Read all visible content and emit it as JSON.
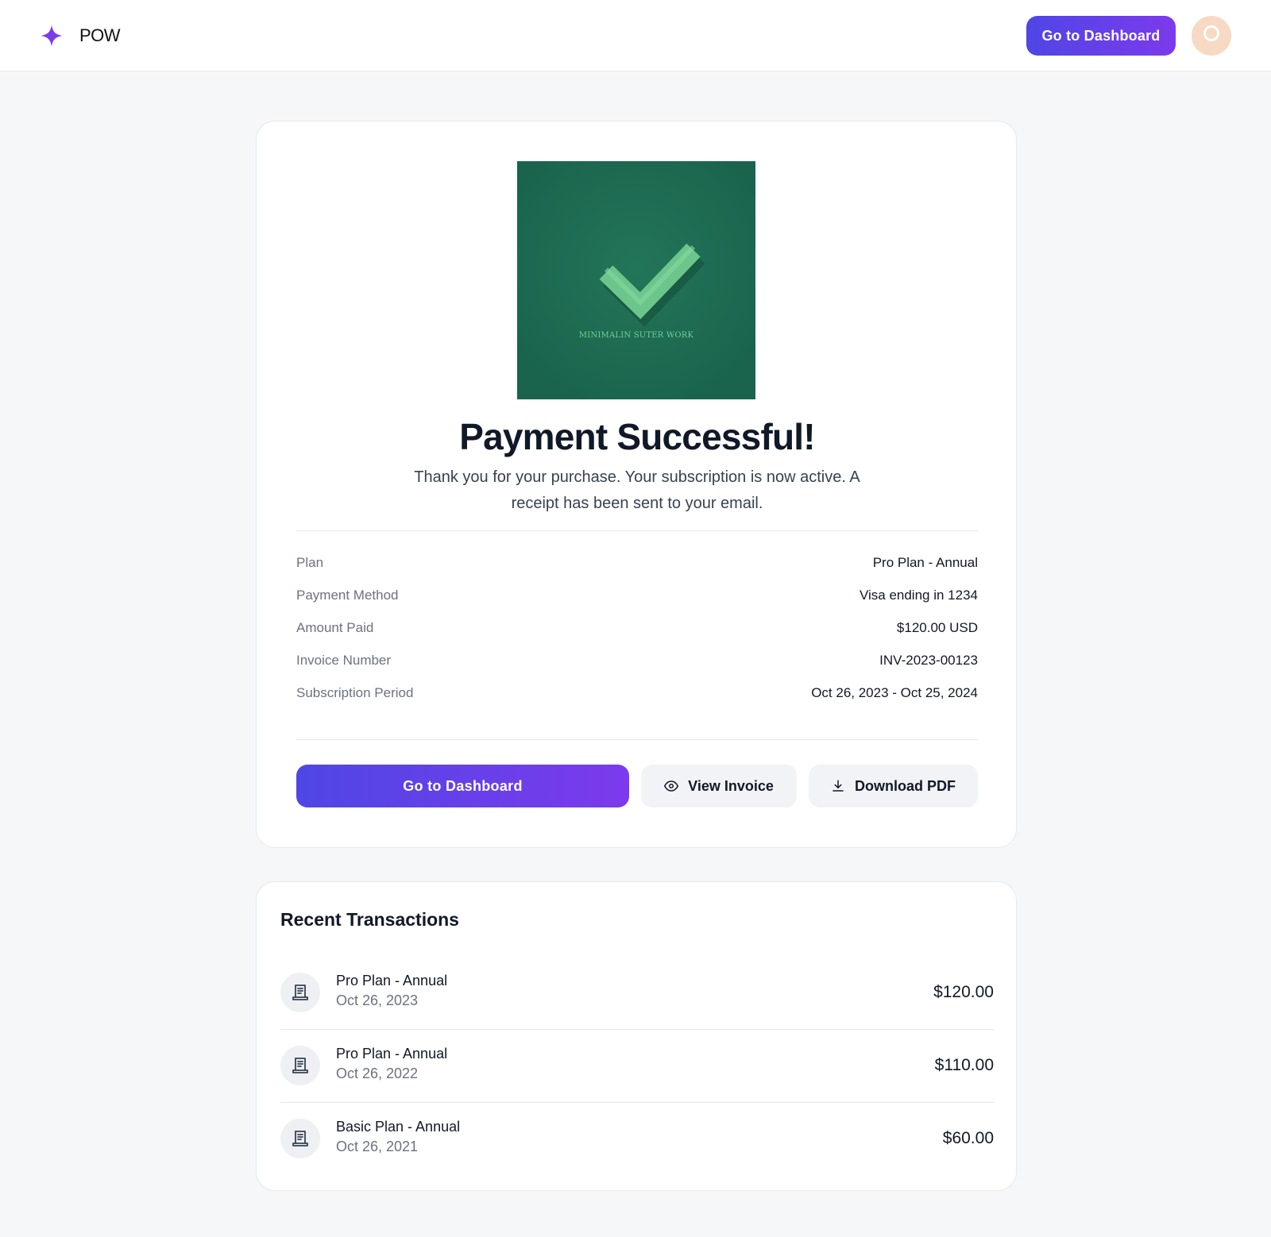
{
  "header": {
    "brand_name": "POW",
    "dashboard_label": "Go to Dashboard",
    "brand_icon": "sparkle-icon",
    "accent_gradient": [
      "#4f46e5",
      "#7c3aed"
    ],
    "avatar_color": "#f7d9c4"
  },
  "hero": {
    "caption": "MINIMALIN SUTER WORK",
    "background": "#1d6b53",
    "check_color": "#6cc58a",
    "icon": "checkmark-icon"
  },
  "main": {
    "title": "Payment Successful!",
    "subtitle": "Thank you for your purchase. Your subscription is now active. A receipt has been sent to your email.",
    "details": [
      {
        "label": "Plan",
        "value": "Pro Plan - Annual"
      },
      {
        "label": "Payment Method",
        "value": "Visa ending in 1234"
      },
      {
        "label": "Amount Paid",
        "value": "$120.00 USD"
      },
      {
        "label": "Invoice Number",
        "value": "INV-2023-00123"
      },
      {
        "label": "Subscription Period",
        "value": "Oct 26, 2023 - Oct 25, 2024"
      }
    ],
    "actions": {
      "dashboard_label": "Go to Dashboard",
      "view_invoice_label": "View Invoice",
      "download_pdf_label": "Download PDF"
    }
  },
  "transactions": {
    "title": "Recent Transactions",
    "items": [
      {
        "name": "Pro Plan - Annual",
        "date": "Oct 26, 2023",
        "amount": "$120.00"
      },
      {
        "name": "Pro Plan - Annual",
        "date": "Oct 26, 2022",
        "amount": "$110.00"
      },
      {
        "name": "Basic Plan - Annual",
        "date": "Oct 26, 2021",
        "amount": "$60.00"
      }
    ]
  }
}
